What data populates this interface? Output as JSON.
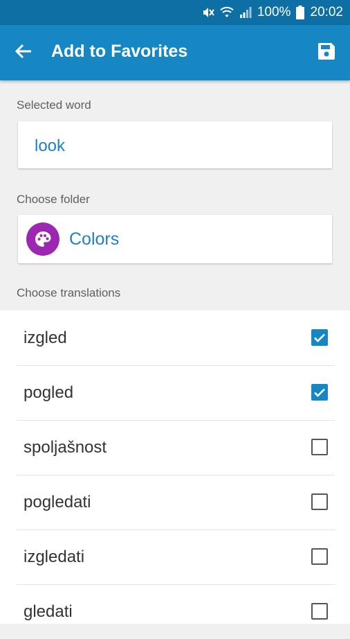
{
  "status_bar": {
    "battery": "100%",
    "time": "20:02",
    "icons": [
      "mute-icon",
      "wifi-icon",
      "signal-icon",
      "battery-icon"
    ]
  },
  "app_bar": {
    "title": "Add to Favorites",
    "back_icon": "arrow-back-icon",
    "save_icon": "save-icon"
  },
  "selected_word": {
    "label": "Selected word",
    "value": "look"
  },
  "folder": {
    "label": "Choose folder",
    "name": "Colors",
    "icon": "palette-icon",
    "icon_color": "#9c27b0"
  },
  "translations": {
    "label": "Choose translations",
    "items": [
      {
        "text": "izgled",
        "checked": true
      },
      {
        "text": "pogled",
        "checked": true
      },
      {
        "text": "spoljašnost",
        "checked": false
      },
      {
        "text": "pogledati",
        "checked": false
      },
      {
        "text": "izgledati",
        "checked": false
      },
      {
        "text": "gledati",
        "checked": false
      }
    ]
  },
  "colors": {
    "status_bar": "#0d6fa3",
    "app_bar": "#1787c4",
    "accent_text": "#1f7fc0",
    "checkbox_on": "#1787c4"
  }
}
